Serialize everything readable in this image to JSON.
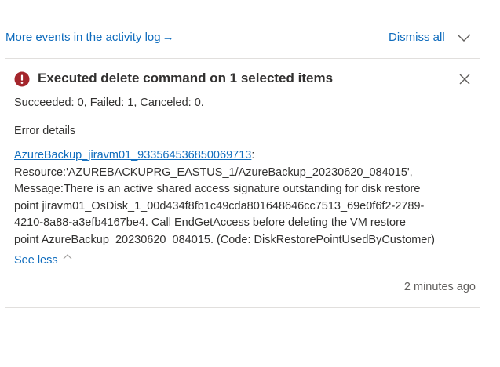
{
  "header": {
    "activity_log_link": "More events in the activity log",
    "activity_log_arrow": "→",
    "dismiss_all_label": "Dismiss all"
  },
  "notification": {
    "icon": "error-icon",
    "title": "Executed delete command on 1 selected items",
    "summary": "Succeeded: 0, Failed: 1, Canceled: 0.",
    "details_heading": "Error details",
    "resource_link": "AzureBackup_jiravm01_933564536850069713",
    "resource_link_suffix": ":",
    "detail_lines": [
      "Resource:'AZUREBACKUPRG_EASTUS_1/AzureBackup_20230620_084015',",
      "Message:There is an active shared access signature outstanding for disk restore",
      "point jiravm01_OsDisk_1_00d434f8fb1c49cda801648646cc7513_69e0f6f2-2789-",
      "4210-8a88-a3efb4167be4. Call EndGetAccess before deleting the VM restore",
      "point AzureBackup_20230620_084015. (Code: DiskRestorePointUsedByCustomer)"
    ],
    "see_less_label": "See less",
    "timestamp": "2 minutes ago"
  },
  "colors": {
    "link": "#0f6cbd",
    "error": "#a4262c",
    "text": "#323130",
    "muted": "#605e5c",
    "divider": "#e1dfdd"
  }
}
